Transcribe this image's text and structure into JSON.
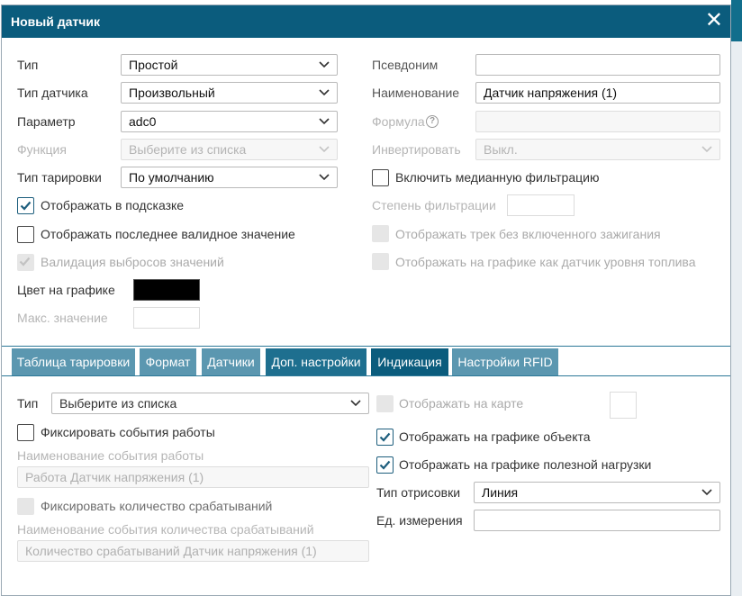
{
  "dialog": {
    "title": "Новый датчик"
  },
  "left": {
    "type": {
      "label": "Тип",
      "value": "Простой"
    },
    "sensor_type": {
      "label": "Тип датчика",
      "value": "Произвольный"
    },
    "parameter": {
      "label": "Параметр",
      "value": "adc0"
    },
    "function": {
      "label": "Функция",
      "value": "Выберите из списка"
    },
    "calibration_type": {
      "label": "Тип тарировки",
      "value": "По умолчанию"
    },
    "show_in_tooltip": {
      "label": "Отображать в подсказке",
      "checked": true
    },
    "show_last_valid": {
      "label": "Отображать последнее валидное значение",
      "checked": false
    },
    "outlier_validation": {
      "label": "Валидация выбросов значений",
      "checked": true,
      "disabled": true
    },
    "graph_color": {
      "label": "Цвет на графике",
      "value": "#000000"
    },
    "max_value": {
      "label": "Макс. значение",
      "value": ""
    }
  },
  "right": {
    "alias": {
      "label": "Псевдоним",
      "value": ""
    },
    "name": {
      "label": "Наименование",
      "value": "Датчик напряжения (1)"
    },
    "formula": {
      "label": "Формула",
      "value": ""
    },
    "invert": {
      "label": "Инвертировать",
      "value": "Выкл."
    },
    "median_filter": {
      "label": "Включить медианную фильтрацию",
      "checked": false
    },
    "filter_degree": {
      "label": "Степень фильтрации",
      "value": ""
    },
    "track_no_ignition": {
      "label": "Отображать трек без включенного зажигания"
    },
    "fuel_graph": {
      "label": "Отображать на графике как датчик уровня топлива"
    }
  },
  "tabs": [
    {
      "label": "Таблица тарировки"
    },
    {
      "label": "Формат"
    },
    {
      "label": "Датчики"
    },
    {
      "label": "Доп. настройки"
    },
    {
      "label": "Индикация"
    },
    {
      "label": "Настройки RFID"
    }
  ],
  "tab_panel": {
    "type": {
      "label": "Тип",
      "placeholder": "Выберите из списка"
    },
    "fix_work_events": {
      "label": "Фиксировать события работы",
      "checked": false
    },
    "work_event_name": {
      "label": "Наименование события работы",
      "value": "Работа Датчик напряжения (1)"
    },
    "fix_trigger_count": {
      "label": "Фиксировать количество срабатываний"
    },
    "trigger_event_name": {
      "label": "Наименование события количества срабатываний",
      "value": "Количество срабатываний Датчик напряжения (1)"
    },
    "show_on_map": {
      "label": "Отображать на карте"
    },
    "show_on_object_graph": {
      "label": "Отображать на графике объекта",
      "checked": true
    },
    "show_on_payload_graph": {
      "label": "Отображать на графике полезной нагрузки",
      "checked": true
    },
    "draw_type": {
      "label": "Тип отрисовки",
      "value": "Линия"
    },
    "unit": {
      "label": "Ед. измерения",
      "value": ""
    }
  },
  "icons": {
    "close": "close-icon",
    "chevron": "chevron-down-icon",
    "check": "checkmark-icon",
    "help": "question-icon"
  },
  "colors": {
    "header": "#0b5c7d",
    "tab": "#5b97b0",
    "tab_active": "#0b5c7d",
    "check": "#1d5e7d"
  }
}
